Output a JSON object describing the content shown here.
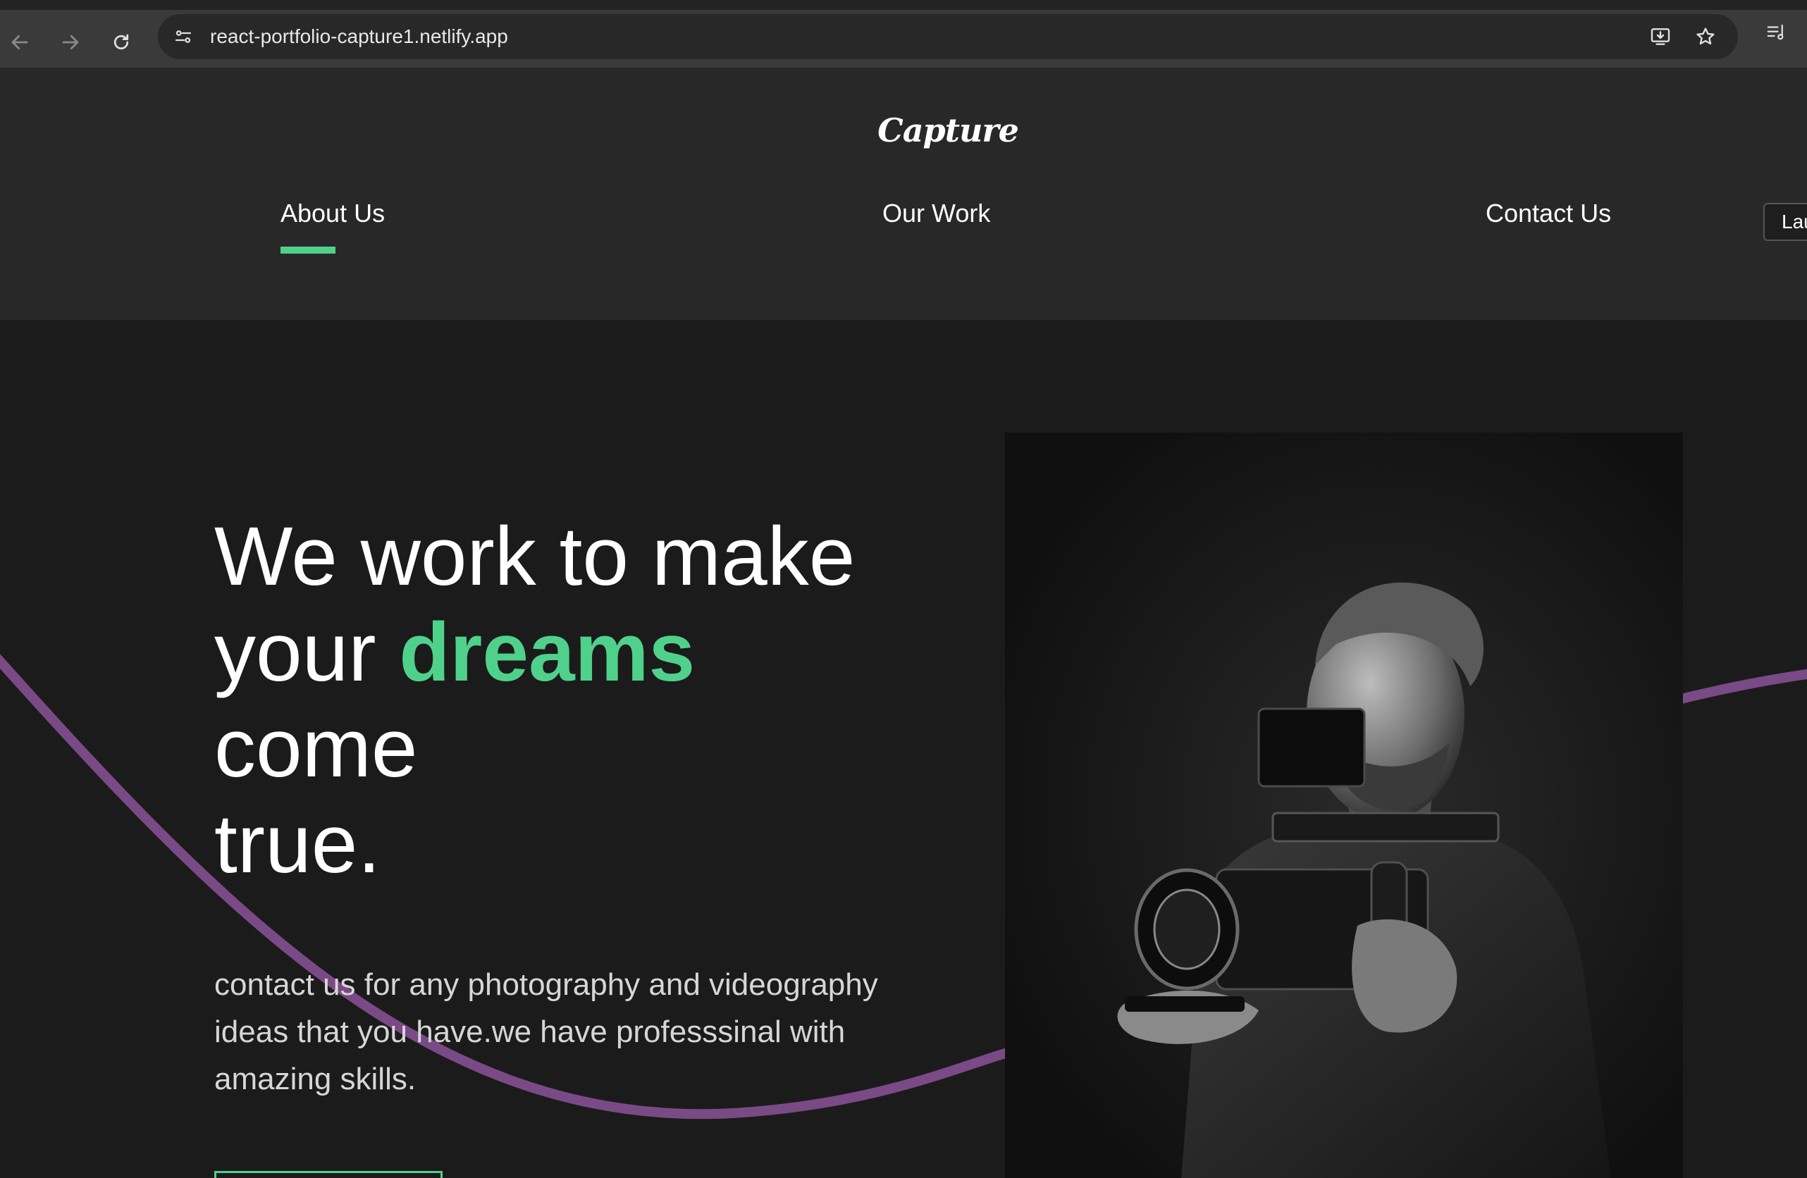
{
  "browser": {
    "url": "react-portfolio-capture1.netlify.app",
    "icons": [
      "back-icon",
      "forward-icon",
      "reload-icon",
      "site-settings-icon",
      "install-app-icon",
      "bookmark-star-icon",
      "reading-list-icon"
    ]
  },
  "site": {
    "logo": "Capture",
    "nav": {
      "about": "About Us",
      "work": "Our Work",
      "contact": "Contact Us",
      "active": "About Us"
    },
    "lang_button": "Lau"
  },
  "hero": {
    "title_line1": "We work to make",
    "title_line2_pre": "your ",
    "title_highlight": "dreams",
    "title_line3": "come",
    "title_line4": "true.",
    "description": "contact us for any photography and videography ideas that you have.we have professsinal with amazing skills."
  },
  "colors": {
    "accent": "#4fd18b",
    "wave": "#7a4a86",
    "header_bg": "#282828",
    "page_bg": "#1b1b1b"
  }
}
